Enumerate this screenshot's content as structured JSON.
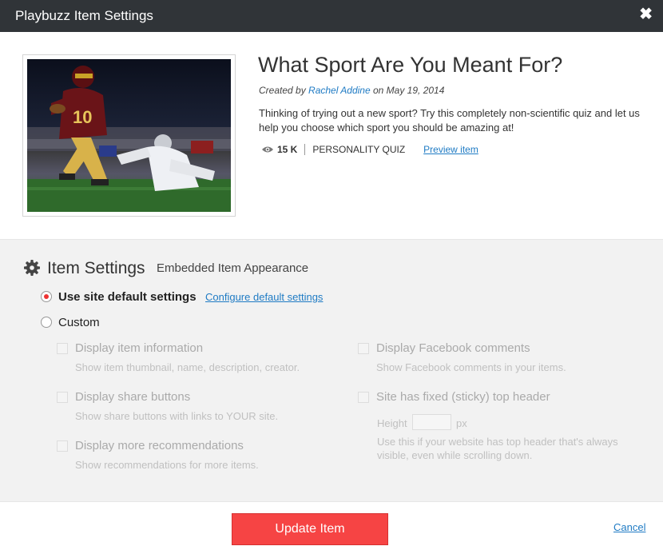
{
  "window": {
    "title": "Playbuzz Item Settings",
    "close_label": "✖"
  },
  "item": {
    "title": "What Sport Are You Meant For?",
    "created_by_prefix": "Created by ",
    "author": "Rachel Addine",
    "date_prefix": " on ",
    "date": "May 19, 2014",
    "description": "Thinking of trying out a new sport? Try this completely non-scientific quiz and let us help you choose which sport you should be amazing at!",
    "views": "15 K",
    "type": "PERSONALITY QUIZ",
    "preview_label": "Preview item",
    "thumbnail_icon": "football-player-image"
  },
  "settings": {
    "title": "Item Settings",
    "subtitle": "Embedded Item Appearance",
    "use_default_label": "Use site default settings",
    "configure_label": "Configure default settings",
    "custom_label": "Custom",
    "options": {
      "item_info": {
        "label": "Display item information",
        "hint": "Show item thumbnail, name, description, creator."
      },
      "share": {
        "label": "Display share buttons",
        "hint": "Show share buttons with links to YOUR site."
      },
      "recommendations": {
        "label": "Display more recommendations",
        "hint": "Show recommendations for more items."
      },
      "facebook": {
        "label": "Display Facebook comments",
        "hint": "Show Facebook comments in your items."
      },
      "sticky": {
        "label": "Site has fixed (sticky) top header",
        "hint": "Use this if your website has top header that's always visible, even while scrolling down."
      }
    },
    "height_label": "Height",
    "height_value": "",
    "height_unit": "px"
  },
  "footer": {
    "update_label": "Update Item",
    "cancel_label": "Cancel"
  },
  "colors": {
    "accent": "#f64444",
    "link": "#1f7bc4",
    "titlebar": "#303438"
  }
}
